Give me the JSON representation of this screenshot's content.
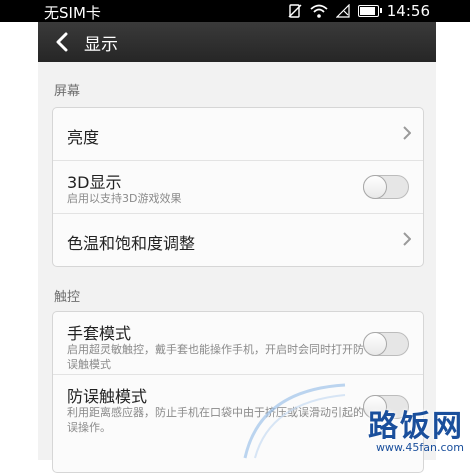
{
  "status_bar": {
    "carrier": "无SIM卡",
    "time": "14:56",
    "battery_percent": 90
  },
  "header": {
    "title": "显示",
    "back_icon": "chevron-left-icon"
  },
  "sections": [
    {
      "label": "屏幕",
      "items": [
        {
          "title": "亮度",
          "control": "chevron"
        },
        {
          "title": "3D显示",
          "subtitle": "启用以支持3D游戏效果",
          "control": "toggle",
          "on": false
        },
        {
          "title": "色温和饱和度调整",
          "control": "chevron"
        }
      ]
    },
    {
      "label": "触控",
      "items": [
        {
          "title": "手套模式",
          "subtitle": "启用超灵敏触控，戴手套也能操作手机，开启时会同时打开防误触模式",
          "control": "toggle",
          "on": false
        },
        {
          "title": "防误触模式",
          "subtitle": "利用距离感应器，防止手机在口袋中由于挤压或误滑动引起的误操作。",
          "control": "toggle",
          "on": false
        }
      ]
    }
  ],
  "watermark": {
    "logo_text": "路饭网",
    "url": "www.45fan.com"
  },
  "colors": {
    "titlebar": "#2f2f2f",
    "background": "#f2f2f2",
    "card": "#fbfbfb",
    "watermark": "#1a4f9c"
  }
}
